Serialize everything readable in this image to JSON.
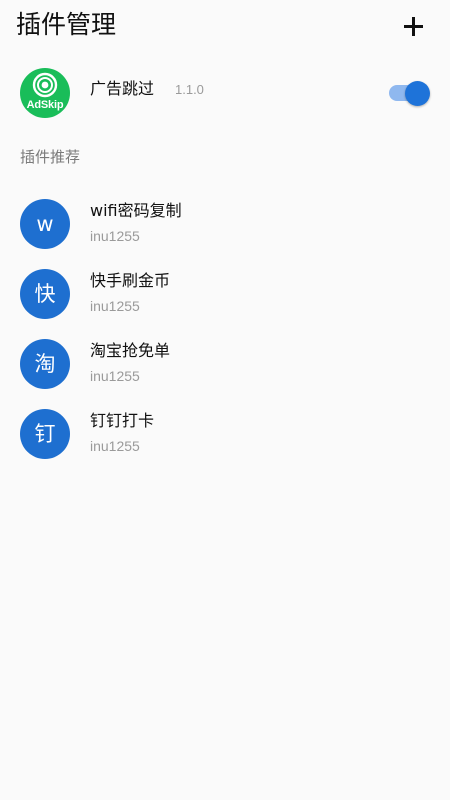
{
  "header": {
    "title": "插件管理",
    "add_icon": "plus-icon"
  },
  "installed": {
    "name": "广告跳过",
    "version": "1.1.0",
    "icon_label": "AdSkip",
    "icon_color": "#19bd59",
    "enabled": true,
    "toggle_color": "#1e73d9"
  },
  "recommend": {
    "label": "插件推荐",
    "items": [
      {
        "avatar": "w",
        "title": "wifi密码复制",
        "author": "inu1255"
      },
      {
        "avatar": "快",
        "title": "快手刷金币",
        "author": "inu1255"
      },
      {
        "avatar": "淘",
        "title": "淘宝抢免单",
        "author": "inu1255"
      },
      {
        "avatar": "钉",
        "title": "钉钉打卡",
        "author": "inu1255"
      }
    ],
    "avatar_color": "#1e6fd0"
  }
}
